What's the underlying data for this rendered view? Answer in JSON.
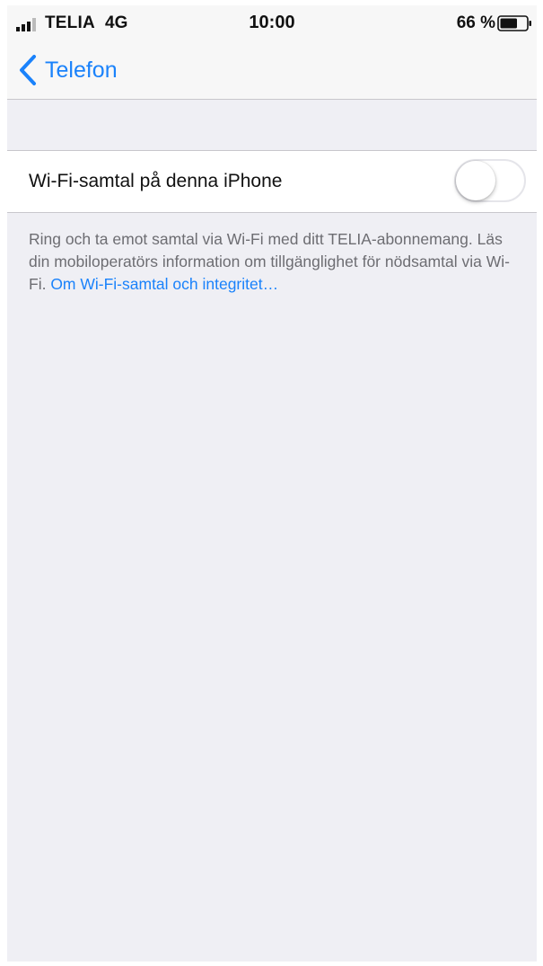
{
  "status_bar": {
    "carrier": "TELIA",
    "network": "4G",
    "time": "10:00",
    "battery_percent": "66 %",
    "battery_level": 0.66
  },
  "nav": {
    "back_label": "Telefon",
    "back_icon": "chevron-left-icon"
  },
  "settings": {
    "wifi_calling_label": "Wi-Fi-samtal på denna iPhone",
    "wifi_calling_enabled": false
  },
  "footer": {
    "description": "Ring och ta emot samtal via Wi-Fi med ditt TELIA-abonnemang. Läs din mobiloperatörs information om tillgänglighet för nödsamtal via Wi-Fi. ",
    "link_text": "Om Wi-Fi-samtal och integritet…"
  },
  "colors": {
    "accent": "#1a82fb",
    "background": "#efeff4",
    "secondary_text": "#6d6d72"
  }
}
